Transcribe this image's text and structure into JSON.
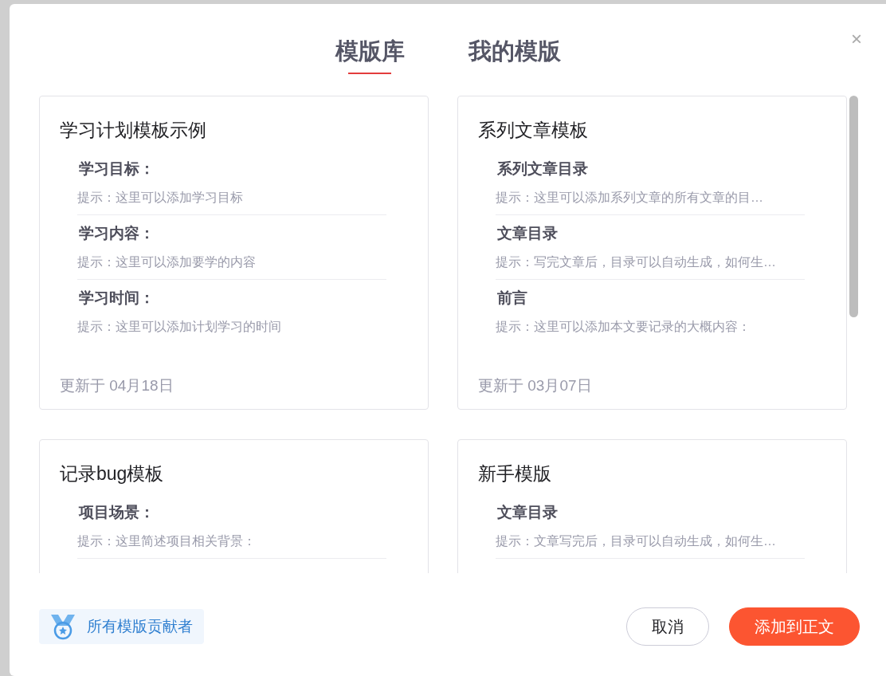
{
  "tabs": [
    {
      "label": "模版库",
      "selected": true
    },
    {
      "label": "我的模版",
      "selected": false
    }
  ],
  "close": "×",
  "cards": [
    {
      "title": "学习计划模板示例",
      "sections": [
        {
          "heading": "学习目标：",
          "hint": "提示：这里可以添加学习目标"
        },
        {
          "heading": "学习内容：",
          "hint": "提示：这里可以添加要学的内容"
        },
        {
          "heading": "学习时间：",
          "hint": "提示：这里可以添加计划学习的时间"
        }
      ],
      "updated": "更新于 04月18日"
    },
    {
      "title": "系列文章模板",
      "sections": [
        {
          "heading": "系列文章目录",
          "hint": "提示：这里可以添加系列文章的所有文章的目…"
        },
        {
          "heading": "文章目录",
          "hint": "提示：写完文章后，目录可以自动生成，如何生…"
        },
        {
          "heading": "前言",
          "hint": "提示：这里可以添加本文要记录的大概内容："
        }
      ],
      "updated": "更新于 03月07日"
    },
    {
      "title": "记录bug模板",
      "sections": [
        {
          "heading": "项目场景：",
          "hint": "提示：这里简述项目相关背景："
        }
      ]
    },
    {
      "title": "新手模版",
      "sections": [
        {
          "heading": "文章目录",
          "hint": "提示：文章写完后，目录可以自动生成，如何生…"
        }
      ]
    }
  ],
  "contributors": "所有模版贡献者",
  "buttons": [
    {
      "label": "取消",
      "kind": "secondary"
    },
    {
      "label": "添加到正文",
      "kind": "primary"
    }
  ]
}
